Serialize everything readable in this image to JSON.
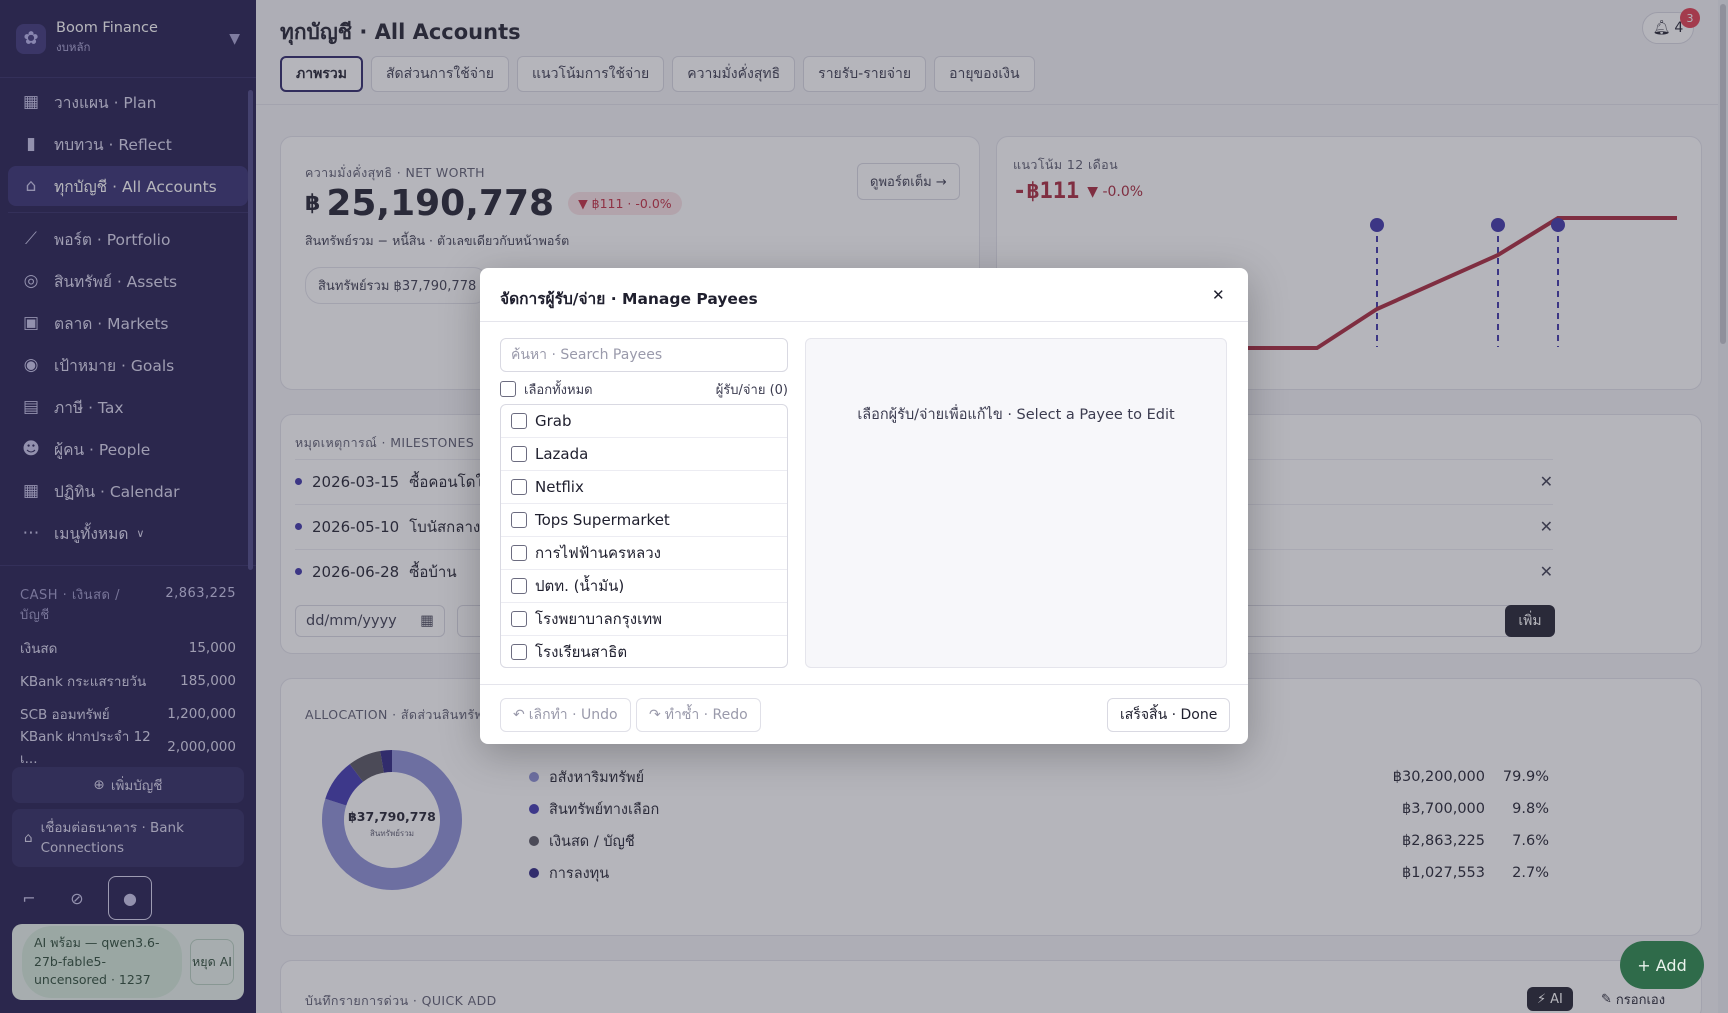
{
  "app": {
    "name": "Boom Finance",
    "subtitle": "งบหลัก"
  },
  "nav": [
    {
      "label": "วางแผน · Plan",
      "icon": "plan-icon"
    },
    {
      "label": "ทบทวน · Reflect",
      "icon": "chart-bars-icon"
    },
    {
      "label": "ทุกบัญชี · All Accounts",
      "icon": "bank-icon",
      "active": true
    },
    {
      "label": "พอร์ต · Portfolio",
      "icon": "line-chart-icon"
    },
    {
      "label": "สินทรัพย์ · Assets",
      "icon": "watch-icon"
    },
    {
      "label": "ตลาด · Markets",
      "icon": "image-icon"
    },
    {
      "label": "เป้าหมาย · Goals",
      "icon": "target-icon"
    },
    {
      "label": "ภาษี · Tax",
      "icon": "document-icon"
    },
    {
      "label": "ผู้คน · People",
      "icon": "people-icon"
    },
    {
      "label": "ปฏิทิน · Calendar",
      "icon": "calendar-icon"
    },
    {
      "label": "เมนูทั้งหมด",
      "icon": "more-icon"
    }
  ],
  "cash": {
    "header_label": "CASH · เงินสด / บัญชี",
    "header_value": "2,863,225",
    "rows": [
      {
        "name": "เงินสด",
        "value": "15,000"
      },
      {
        "name": "KBank กระแสรายวัน",
        "value": "185,000"
      },
      {
        "name": "SCB ออมทรัพย์",
        "value": "1,200,000"
      },
      {
        "name": "KBank ฝากประจำ 12 เ...",
        "value": "2,000,000"
      }
    ]
  },
  "sidebar_buttons": {
    "add_account": "เพิ่มบัญชี",
    "bank_connections": "เชื่อมต่อธนาคาร · Bank Connections"
  },
  "ai": {
    "status": "AI พร้อม — qwen3.6-27b-fable5-uncensored · 1237",
    "stop": "หยุด AI"
  },
  "header": {
    "title": "ทุกบัญชี · All Accounts",
    "bell_count": "4",
    "badge": "3"
  },
  "tabs": [
    "ภาพรวม",
    "สัดส่วนการใช้จ่าย",
    "แนวโน้มการใช้จ่าย",
    "ความมั่งคั่งสุทธิ",
    "รายรับ-รายจ่าย",
    "อายุของเงิน"
  ],
  "networth": {
    "label": "ความมั่งคั่งสุทธิ · NET WORTH",
    "currency": "฿",
    "value": "25,190,778",
    "change": "▼ ฿111 · -0.0%",
    "note": "สินทรัพย์รวม − หนี้สิน · ตัวเลขเดียวกับหน้าพอร์ต",
    "view_port": "ดูพอร์ตเต็ม →",
    "assets_chip": "สินทรัพย์รวม ฿37,790,778"
  },
  "trend": {
    "label": "แนวโน้ม 12 เดือน",
    "value": "-฿111",
    "change": "▼ -0.0%",
    "line_color": "#a8263a",
    "marker_color": "#3c32a8"
  },
  "milestones": {
    "label": "หมุดเหตุการณ์ · MILESTONES",
    "items": [
      {
        "date": "2026-03-15",
        "text": "ซื้อคอนโดใ"
      },
      {
        "date": "2026-05-10",
        "text": "โบนัสกลางปี"
      },
      {
        "date": "2026-06-28",
        "text": "ซื้อบ้าน"
      }
    ],
    "date_placeholder": "dd/mm/yyyy",
    "add": "เพิ่ม"
  },
  "allocation": {
    "label": "ALLOCATION · สัดส่วนสินทรัพย์",
    "center_value": "฿37,790,778",
    "center_label": "สินทรัพย์รวม",
    "items": [
      {
        "name": "อสังหาริมทรัพย์",
        "value": "฿30,200,000",
        "pct": "79.9%",
        "color": "#8b8fd6",
        "share": 0.799
      },
      {
        "name": "สินทรัพย์ทางเลือก",
        "value": "฿3,700,000",
        "pct": "9.8%",
        "color": "#3e36b0",
        "share": 0.098
      },
      {
        "name": "เงินสด / บัญชี",
        "value": "฿2,863,225",
        "pct": "7.6%",
        "color": "#55535e",
        "share": 0.076
      },
      {
        "name": "การลงทุน",
        "value": "฿1,027,553",
        "pct": "2.7%",
        "color": "#2a2380",
        "share": 0.027
      }
    ]
  },
  "quickadd": {
    "label": "บันทึกรายการด่วน · QUICK ADD",
    "ai": "AI",
    "manual": "กรอกเอง"
  },
  "fab": "+ Add",
  "modal": {
    "title": "จัดการผู้รับ/จ่าย · Manage Payees",
    "search_placeholder": "ค้นหา · Search Payees",
    "select_all": "เลือกทั้งหมด",
    "count": "ผู้รับ/จ่าย (0)",
    "payees": [
      "Grab",
      "Lazada",
      "Netflix",
      "Tops Supermarket",
      "การไฟฟ้านครหลวง",
      "ปตท. (น้ำมัน)",
      "โรงพยาบาลกรุงเทพ",
      "โรงเรียนสาธิต"
    ],
    "empty_state": "เลือกผู้รับ/จ่ายเพื่อแก้ไข · Select a Payee to Edit",
    "undo": "เลิกทำ · Undo",
    "redo": "ทำซ้ำ · Redo",
    "done": "เสร็จสิ้น · Done"
  }
}
